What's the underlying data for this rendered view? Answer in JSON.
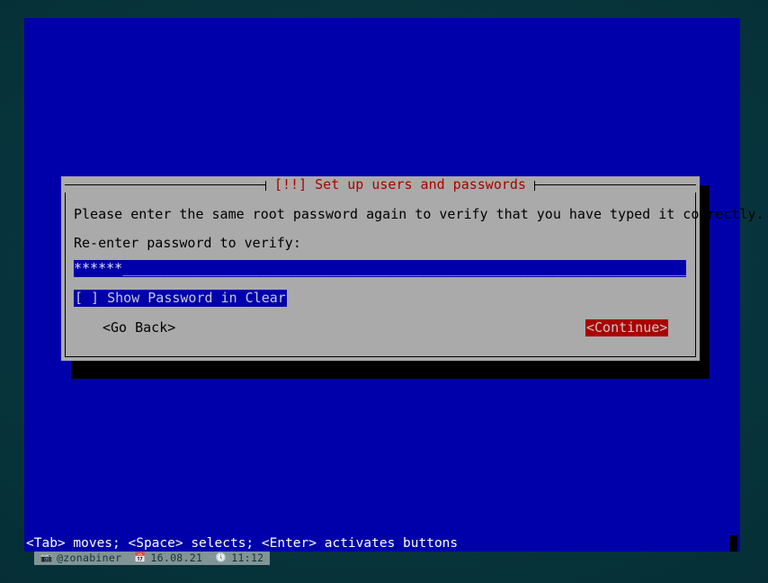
{
  "screen": {
    "background_color": "#063038",
    "terminal_color": "#0000aa"
  },
  "dialog": {
    "title": "[!!] Set up users and passwords",
    "title_color": "#aa0000",
    "background_color": "#aaaaaa",
    "prompt": "Please enter the same root password again to verify that you have typed it correctly.",
    "field_label": "Re-enter password to verify:",
    "password": {
      "masked_value": "******",
      "filler": "_______________________________________________________________________",
      "field_background": "#0000aa"
    },
    "checkbox": {
      "label": "[ ] Show Password in Clear",
      "checked": false,
      "highlight_color": "#0000aa"
    },
    "buttons": {
      "go_back": "<Go Back>",
      "continue": "<Continue>",
      "continue_selected": true,
      "continue_background": "#aa0000"
    }
  },
  "statusbar": {
    "help_text": "<Tab> moves; <Space> selects; <Enter> activates buttons",
    "background_color": "#0000aa",
    "text_color": "#ffffff"
  },
  "watermark": {
    "camera_icon": "὏7",
    "username": "@zonabiner",
    "calendar_icon": "Ὄ5",
    "date": "16.08.21",
    "clock_icon": "ὕ4",
    "time": "11:12"
  }
}
